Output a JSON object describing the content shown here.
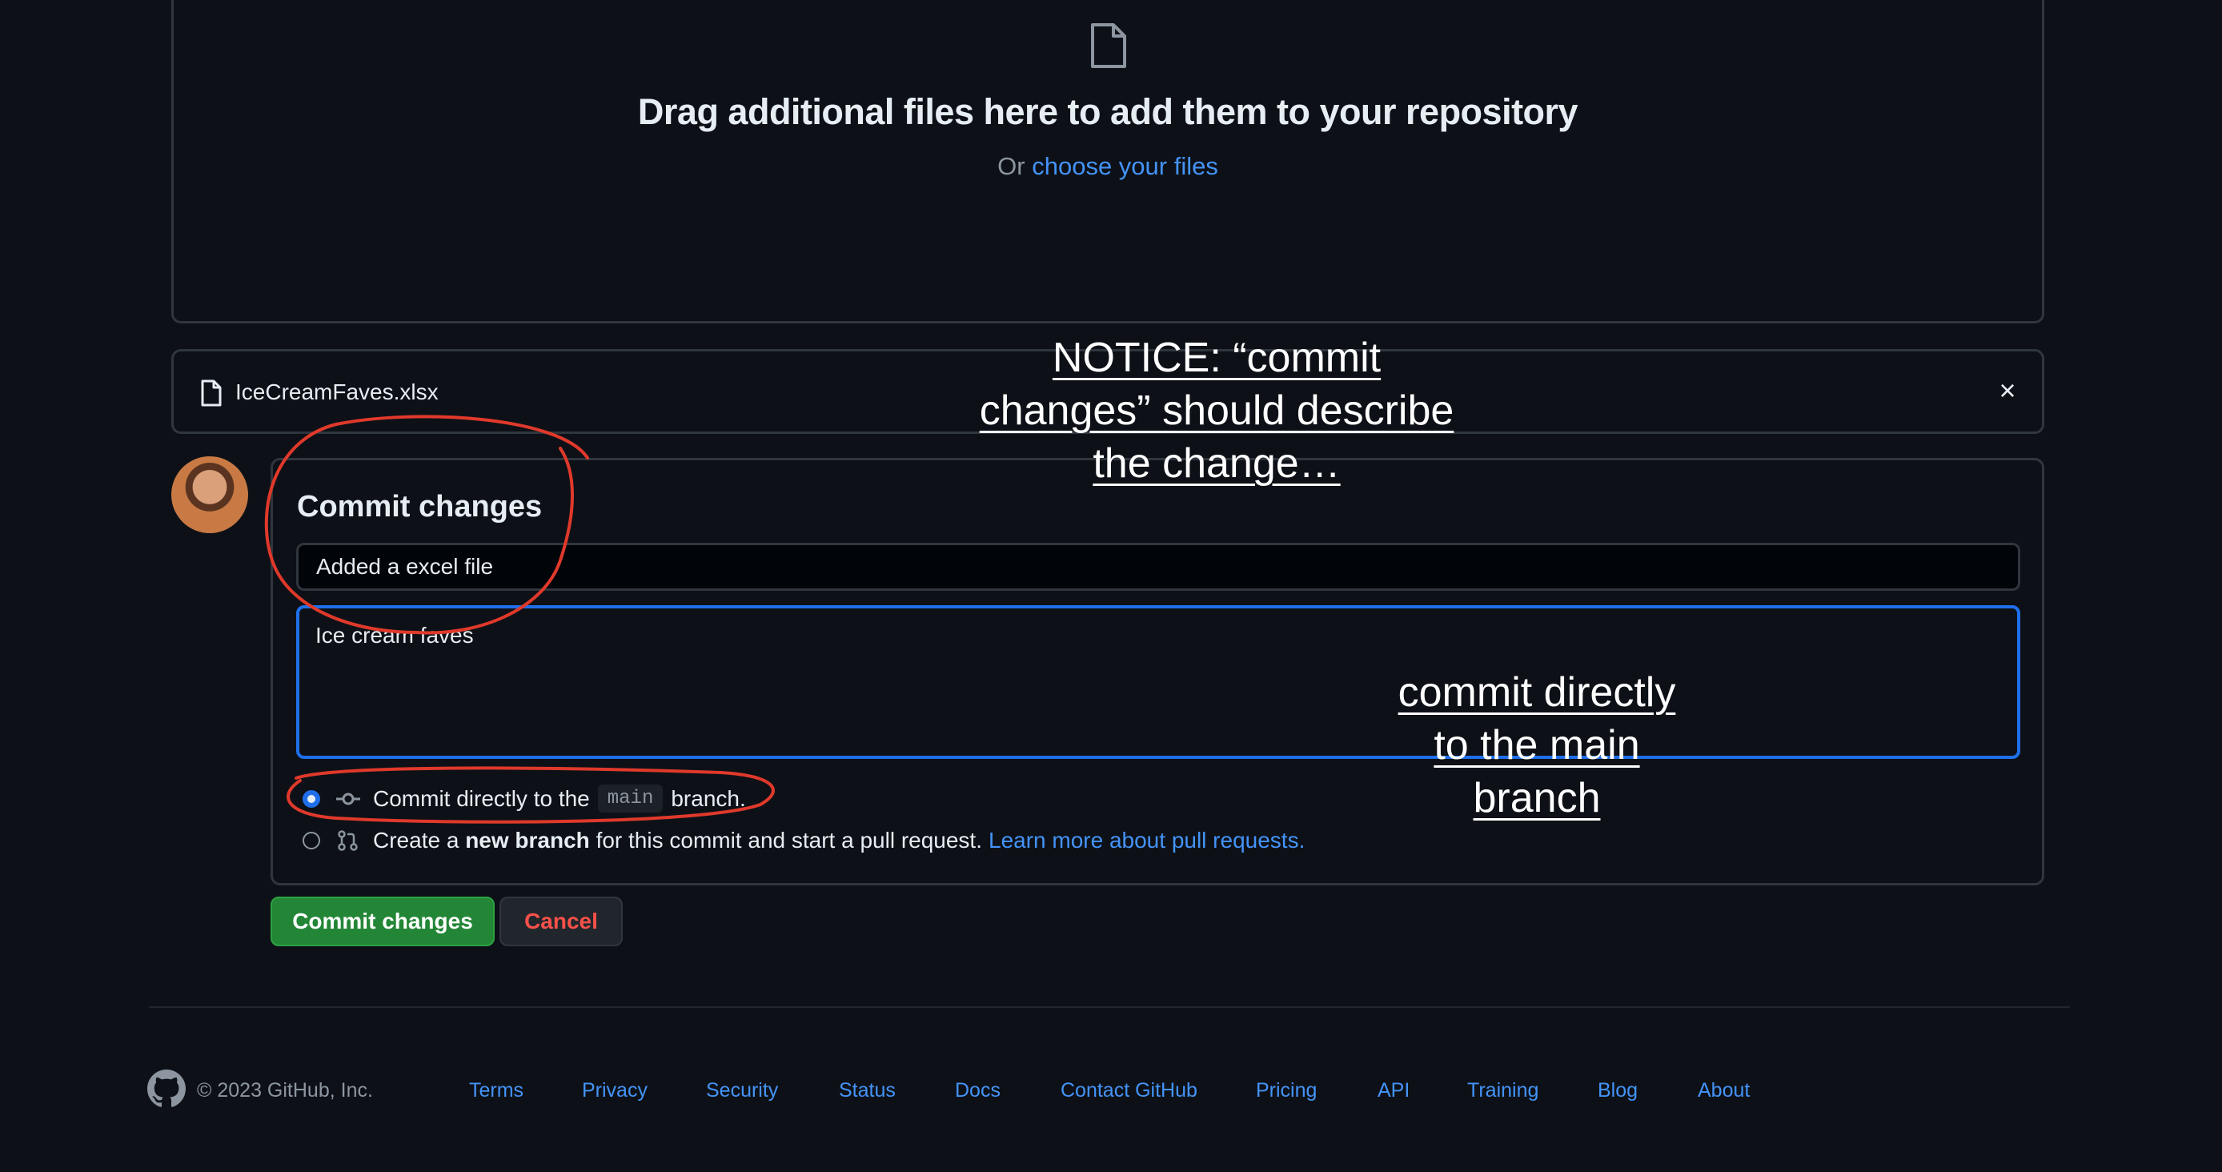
{
  "dropzone": {
    "title": "Drag additional files here to add them to your repository",
    "sub_prefix": "Or",
    "choose_link": "choose your files"
  },
  "file": {
    "name": "IceCreamFaves.xlsx",
    "remove_icon": "×"
  },
  "commit": {
    "heading": "Commit changes",
    "summary_value": "Added a excel file",
    "description_value": "Ice cream faves",
    "option_direct": {
      "prefix": "Commit directly to the",
      "branch": "main",
      "suffix": "branch.",
      "selected": true
    },
    "option_new_branch": {
      "prefix": "Create a",
      "bold": "new branch",
      "suffix": "for this commit and start a pull request.",
      "link": "Learn more about pull requests.",
      "selected": false
    },
    "submit_label": "Commit changes",
    "cancel_label": "Cancel"
  },
  "footer": {
    "copyright": "© 2023 GitHub, Inc.",
    "links": [
      "Terms",
      "Privacy",
      "Security",
      "Status",
      "Docs",
      "Contact GitHub",
      "Pricing",
      "API",
      "Training",
      "Blog",
      "About"
    ]
  },
  "annotations": {
    "note_1_lines": [
      "NOTICE: “commit",
      "changes” should describe",
      "the change…"
    ],
    "note_2_lines": [
      "commit directly",
      "to the main",
      "branch"
    ],
    "scribble_color": "#e0392b"
  },
  "colors": {
    "background": "#0d1117",
    "accent_blue": "#4493f8",
    "primary_green": "#238636",
    "danger_red": "#f85149"
  }
}
